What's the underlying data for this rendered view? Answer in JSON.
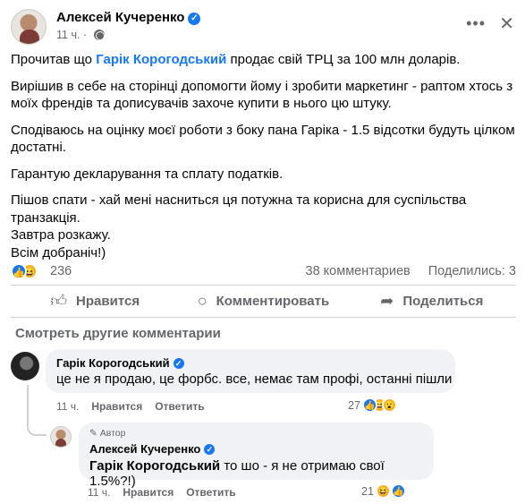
{
  "post": {
    "author": "Алексей Кучеренко",
    "time": "11 ч.",
    "body_p1_before": "Прочитав що ",
    "body_p1_mention": "Гарік Корогодський",
    "body_p1_after": " продає свій ТРЦ за 100 млн доларів.",
    "body_p2": "Вирішив в себе на сторінці допомогти йому і зробити маркетинг - раптом хтось з моїх френдів та дописувачів захоче купити в нього цю штуку.",
    "body_p3": "Сподіваюсь на оцінку моєї роботи з боку пана Гаріка - 1.5 відсотки будуть цілком достатні.",
    "body_p4": "Гарантую декларування та сплату податків.",
    "body_p5": "Пішов спати - хай мені насниться ця потужна та корисна для суспільства транзакція.",
    "body_p6": "Завтра розкажу.",
    "body_p7": "Всім добраніч!)"
  },
  "stats": {
    "reactions": "236",
    "comments": "38 комментариев",
    "shares": "Поделились: 3"
  },
  "actions": {
    "like": "Нравится",
    "comment": "Комментировать",
    "share": "Поделиться"
  },
  "comments": {
    "more_label": "Смотреть другие комментарии",
    "c1": {
      "author": "Гарік Корогодський",
      "text": "це не я продаю, це форбс. все, немає там профі, останні пішли",
      "time": "11 ч.",
      "like": "Нравится",
      "reply": "Ответить",
      "reactions": "27"
    },
    "c2": {
      "tag": "Автор",
      "author": "Алексей Кучеренко",
      "mention": "Гарік Корогодський",
      "text": " то шо - я не отримаю свої 1.5%?!)",
      "time": "11 ч.",
      "like": "Нравится",
      "reply": "Ответить",
      "reactions": "21"
    }
  },
  "colors": {
    "accent": "#1877f2",
    "muted": "#65676b",
    "bubble": "#f0f2f5"
  },
  "icons": [
    "verified-badge-icon",
    "globe-icon",
    "more-icon",
    "close-icon",
    "like-icon",
    "haha-icon",
    "wow-icon",
    "comment-icon",
    "share-icon",
    "pen-icon"
  ]
}
